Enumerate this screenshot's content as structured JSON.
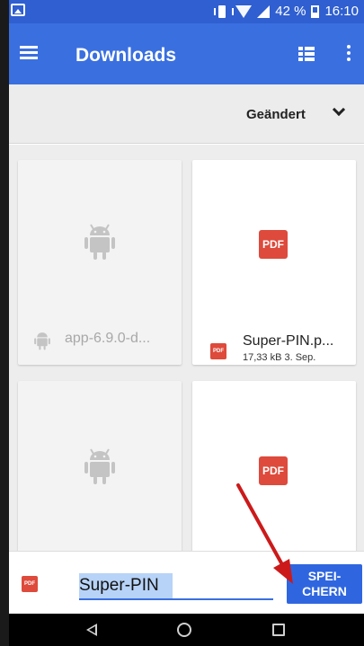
{
  "status_bar": {
    "battery_text": "42 %",
    "time": "16:10"
  },
  "toolbar": {
    "title": "Downloads",
    "menu_icon": "hamburger-menu-icon",
    "list_view_icon": "list-view-icon",
    "overflow_icon": "more-vert-icon"
  },
  "sort": {
    "label": "Geändert",
    "icon": "chevron-down-icon"
  },
  "files": [
    {
      "type": "apk",
      "name": "app-6.9.0-d...",
      "meta": "",
      "disabled": true
    },
    {
      "type": "pdf",
      "name": "Super-PIN.p...",
      "meta": "17,33 kB 3. Sep.",
      "disabled": false
    },
    {
      "type": "apk",
      "name": "",
      "meta": "",
      "disabled": true
    },
    {
      "type": "pdf",
      "name": "",
      "meta": "",
      "disabled": false
    }
  ],
  "pdf_label": "PDF",
  "save_bar": {
    "filename": "Super-PIN",
    "save_label": "SPEI-\nCHERN"
  },
  "colors": {
    "status_bar": "#2f5fd0",
    "toolbar": "#3a6fe0",
    "pdf_red": "#de4a3b",
    "save_button": "#2f66e0",
    "arrow": "#cc1a1a"
  }
}
